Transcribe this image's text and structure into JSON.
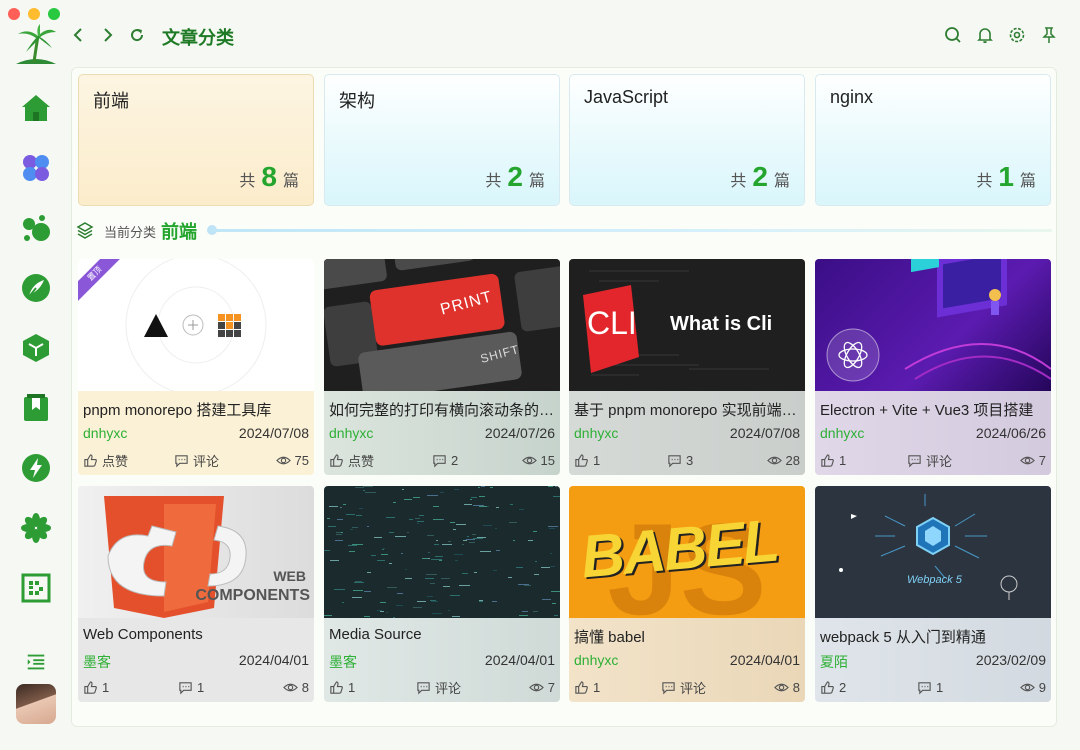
{
  "app": {
    "title": "文章分类"
  },
  "colors": {
    "accent": "#24a52e",
    "brand": "#1f7a26",
    "traffic": [
      "#fe5f57",
      "#febc2e",
      "#28c840"
    ]
  },
  "sidebar": {
    "items": [
      {
        "name": "home",
        "icon": "home-icon"
      },
      {
        "name": "apps",
        "icon": "four-petal-icon"
      },
      {
        "name": "bubbles",
        "icon": "bubbles-icon"
      },
      {
        "name": "write",
        "icon": "feather-icon"
      },
      {
        "name": "cube",
        "icon": "cube-icon"
      },
      {
        "name": "bookmark",
        "icon": "bookmark-icon"
      },
      {
        "name": "flash",
        "icon": "lightning-icon"
      },
      {
        "name": "flower",
        "icon": "asterisk-icon"
      },
      {
        "name": "qrcode",
        "icon": "qrcode-icon"
      }
    ],
    "collapse_icon": "menu-collapse-icon"
  },
  "toolbar": {
    "icons": [
      "search-icon",
      "bell-icon",
      "gear-icon",
      "pin-icon"
    ]
  },
  "categories": [
    {
      "name": "前端",
      "prefix": "共",
      "count": "8",
      "suffix": "篇",
      "active": true
    },
    {
      "name": "架构",
      "prefix": "共",
      "count": "2",
      "suffix": "篇",
      "active": false
    },
    {
      "name": "JavaScript",
      "prefix": "共",
      "count": "2",
      "suffix": "篇",
      "active": false
    },
    {
      "name": "nginx",
      "prefix": "共",
      "count": "1",
      "suffix": "篇",
      "active": false
    }
  ],
  "current": {
    "label": "当前分类",
    "value": "前端"
  },
  "articles": [
    {
      "title": "pnpm monorepo 搭建工具库",
      "author": "dnhyxc",
      "date": "2024/07/08",
      "likes": "点赞",
      "comments": "评论",
      "views": "75",
      "pinned": "置顶",
      "thumb": "pnpm"
    },
    {
      "title": "如何完整的打印有横向滚动条的页面",
      "author": "dnhyxc",
      "date": "2024/07/26",
      "likes": "点赞",
      "comments": "2",
      "views": "15",
      "thumb": "print",
      "thumb_keys": [
        "PRINT",
        "SHIFT"
      ]
    },
    {
      "title": "基于 pnpm monorepo 实现前端脚手架",
      "author": "dnhyxc",
      "date": "2024/07/08",
      "likes": "1",
      "comments": "3",
      "views": "28",
      "thumb": "cli",
      "thumb_text": "What is Cli",
      "thumb_logo": "CLI"
    },
    {
      "title": "Electron + Vite + Vue3 项目搭建",
      "author": "dnhyxc",
      "date": "2024/06/26",
      "likes": "1",
      "comments": "评论",
      "views": "7",
      "thumb": "electron"
    },
    {
      "title": "Web Components",
      "author": "墨客",
      "date": "2024/04/01",
      "likes": "1",
      "comments": "1",
      "views": "8",
      "thumb": "webcomp",
      "thumb_text": [
        "WEB",
        "COMPONENTS"
      ]
    },
    {
      "title": "Media Source",
      "author": "墨客",
      "date": "2024/04/01",
      "likes": "1",
      "comments": "评论",
      "views": "7",
      "thumb": "media"
    },
    {
      "title": "搞懂 babel",
      "author": "dnhyxc",
      "date": "2024/04/01",
      "likes": "1",
      "comments": "评论",
      "views": "8",
      "thumb": "babel",
      "thumb_text": "BABEL"
    },
    {
      "title": "webpack 5 从入门到精通",
      "author": "夏陌",
      "date": "2023/02/09",
      "likes": "2",
      "comments": "1",
      "views": "9",
      "thumb": "webpack",
      "thumb_text": "Webpack 5"
    }
  ]
}
